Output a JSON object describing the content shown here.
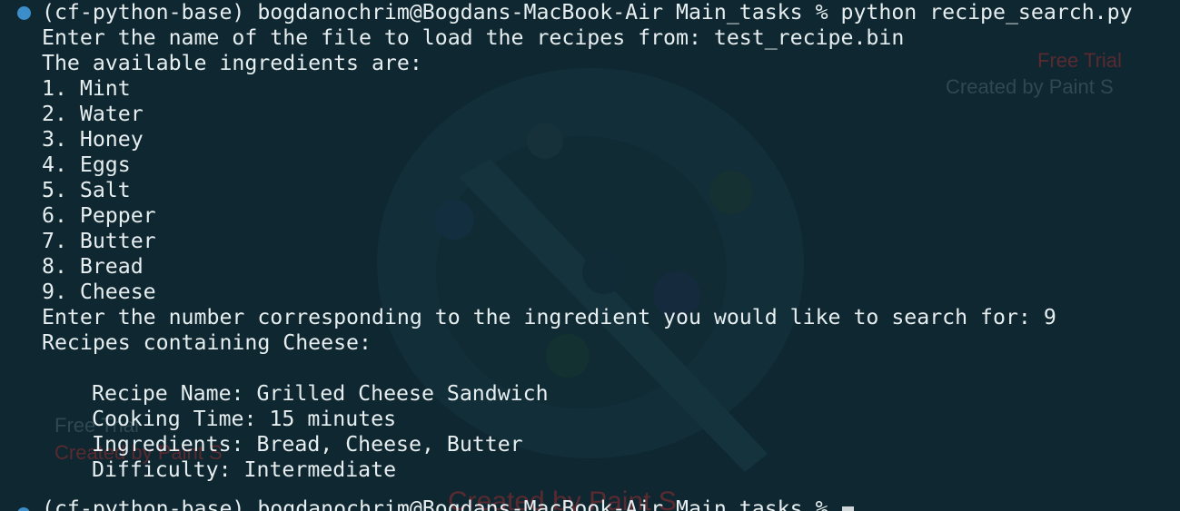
{
  "terminal": {
    "command_line": "(cf-python-base) bogdanochrim@Bogdans-MacBook-Air Main_tasks % python recipe_search.py",
    "lines": [
      "Enter the name of the file to load the recipes from: test_recipe.bin",
      "The available ingredients are:",
      "1. Mint",
      "2. Water",
      "3. Honey",
      "4. Eggs",
      "5. Salt",
      "6. Pepper",
      "7. Butter",
      "8. Bread",
      "9. Cheese",
      "Enter the number corresponding to the ingredient you would like to search for: 9",
      "Recipes containing Cheese:"
    ],
    "recipe": {
      "name_line": "Recipe Name: Grilled Cheese Sandwich",
      "time_line": "Cooking Time: 15 minutes",
      "ingredients_line": "Ingredients: Bread, Cheese, Butter",
      "difficulty_line": "Difficulty: Intermediate"
    },
    "next_prompt": "(cf-python-base) bogdanochrim@Bogdans-MacBook-Air Main_tasks % "
  },
  "watermark": {
    "free_trial": "Free Trial",
    "created_by": "Created by Paint S"
  },
  "colors": {
    "background": "#0f2730",
    "text": "#e6eef0",
    "prompt_dot": "#3b8ec9"
  },
  "icons": {
    "prompt_dot": "circle",
    "watermark": "paint-palette-icon"
  }
}
